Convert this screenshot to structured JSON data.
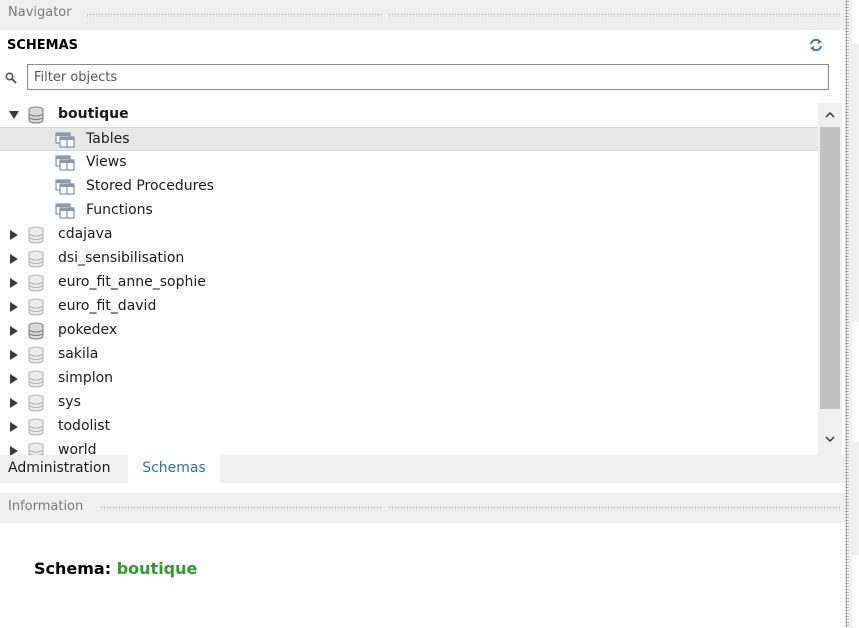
{
  "navigator": {
    "title": "Navigator"
  },
  "schemas_section": {
    "title": "SCHEMAS",
    "refresh_icon": "refresh-icon"
  },
  "filter": {
    "placeholder": "Filter objects",
    "value": "",
    "icon": "search-icon"
  },
  "tree": {
    "expanded_schema": {
      "name": "boutique",
      "children": [
        {
          "label": "Tables",
          "selected": true
        },
        {
          "label": "Views"
        },
        {
          "label": "Stored Procedures"
        },
        {
          "label": "Functions"
        }
      ]
    },
    "collapsed_schemas": [
      "cdajava",
      "dsi_sensibilisation",
      "euro_fit_anne_sophie",
      "euro_fit_david",
      "pokedex",
      "sakila",
      "simplon",
      "sys",
      "todolist",
      "world"
    ]
  },
  "tabs": [
    {
      "label": "Administration",
      "active": false
    },
    {
      "label": "Schemas",
      "active": true
    }
  ],
  "information": {
    "title": "Information",
    "schema_label": "Schema:",
    "schema_name": "boutique"
  },
  "colors": {
    "accent_tab": "#2b6fb6",
    "schema_name": "#2e9a2e",
    "panel_bg": "#f0f0f0"
  }
}
